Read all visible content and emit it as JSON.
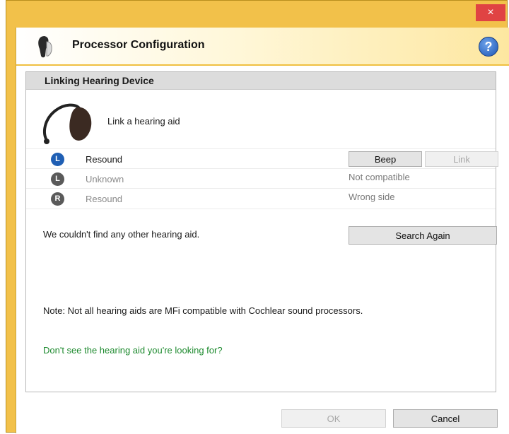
{
  "window": {
    "title": "Processor Configuration",
    "close_glyph": "×",
    "help_glyph": "?",
    "accent_color": "#f2c14a"
  },
  "panel": {
    "title": "Linking Hearing Device",
    "link_label": "Link a hearing aid",
    "devices": [
      {
        "side": "L",
        "name": "Resound",
        "enabled": true,
        "badge_color": "#1f5fb4",
        "status": ""
      },
      {
        "side": "L",
        "name": "Unknown",
        "enabled": false,
        "badge_color": "#5a5a5a",
        "status": "Not compatible"
      },
      {
        "side": "R",
        "name": "Resound",
        "enabled": false,
        "badge_color": "#5a5a5a",
        "status": "Wrong side"
      }
    ],
    "beep_label": "Beep",
    "link_button_label": "Link",
    "no_other_msg": "We couldn't find any other hearing aid.",
    "search_again_label": "Search Again",
    "note": "Note: Not all hearing aids are MFi compatible with Cochlear sound processors.",
    "help_link": "Don't see the hearing aid you're looking for?"
  },
  "footer": {
    "ok_label": "OK",
    "cancel_label": "Cancel"
  }
}
